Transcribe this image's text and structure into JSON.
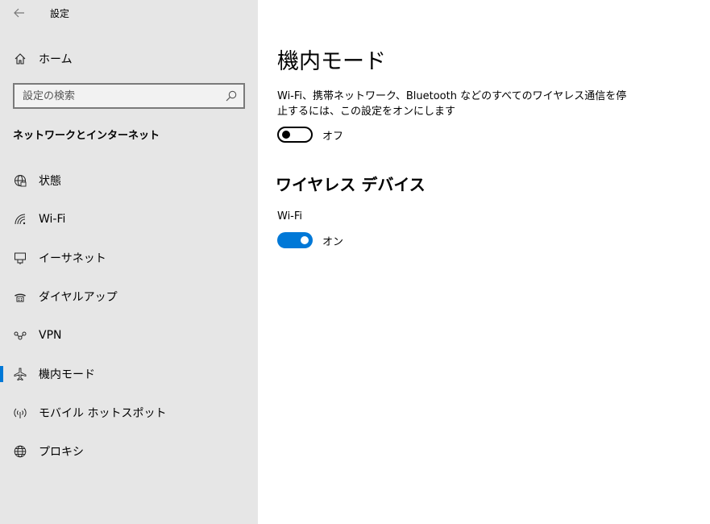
{
  "window": {
    "title": "設定"
  },
  "sidebar": {
    "home_label": "ホーム",
    "search": {
      "placeholder": "設定の検索"
    },
    "section_heading": "ネットワークとインターネット",
    "items": [
      {
        "label": "状態",
        "icon": "globe-status-icon"
      },
      {
        "label": "Wi-Fi",
        "icon": "wifi-icon"
      },
      {
        "label": "イーサネット",
        "icon": "ethernet-icon"
      },
      {
        "label": "ダイヤルアップ",
        "icon": "dialup-icon"
      },
      {
        "label": "VPN",
        "icon": "vpn-icon"
      },
      {
        "label": "機内モード",
        "icon": "airplane-icon",
        "selected": true
      },
      {
        "label": "モバイル ホットスポット",
        "icon": "hotspot-icon"
      },
      {
        "label": "プロキシ",
        "icon": "globe-icon"
      }
    ]
  },
  "main": {
    "title": "機内モード",
    "description": "Wi-Fi、携帯ネットワーク、Bluetooth などのすべてのワイヤレス通信を停止するには、この設定をオンにします",
    "airplane_toggle": {
      "state": "off",
      "state_label": "オフ"
    },
    "wireless_heading": "ワイヤレス デバイス",
    "wifi": {
      "label": "Wi-Fi",
      "state": "on",
      "state_label": "オン"
    }
  },
  "colors": {
    "accent": "#0078d7",
    "sidebar_bg": "#e6e6e6"
  }
}
